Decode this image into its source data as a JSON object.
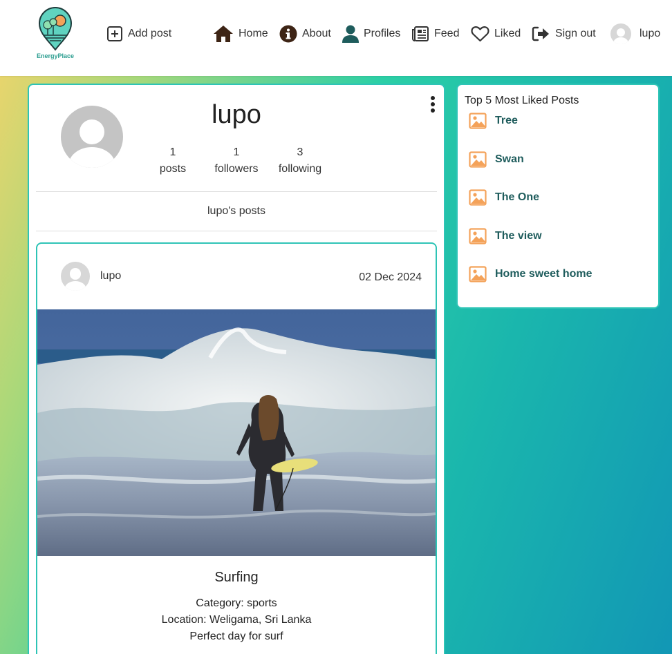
{
  "navbar": {
    "logo_text": "EnergyPlace",
    "items": [
      {
        "label": "Add post",
        "icon": "plus-square-icon"
      },
      {
        "label": "Home",
        "icon": "home-icon"
      },
      {
        "label": "About",
        "icon": "info-circle-icon"
      },
      {
        "label": "Profiles",
        "icon": "user-icon"
      },
      {
        "label": "Feed",
        "icon": "newspaper-icon"
      },
      {
        "label": "Liked",
        "icon": "heart-icon"
      },
      {
        "label": "Sign out",
        "icon": "sign-out-icon"
      }
    ],
    "user_label": "lupo"
  },
  "profile": {
    "name": "lupo",
    "stats": [
      {
        "value": "1",
        "label": "posts"
      },
      {
        "value": "1",
        "label": "followers"
      },
      {
        "value": "3",
        "label": "following"
      }
    ],
    "posts_heading": "lupo's posts"
  },
  "post": {
    "author": "lupo",
    "date": "02 Dec 2024",
    "title": "Surfing",
    "category": "Category: sports",
    "location": "Location: Weligama, Sri Lanka",
    "content": "Perfect day for surf"
  },
  "top_posts": {
    "title": "Top 5 Most Liked Posts",
    "items": [
      "Tree",
      "Swan",
      "The One",
      "The view",
      "Home sweet home"
    ]
  },
  "colors": {
    "accent": "#2ec4b6",
    "link": "#1e5c5c",
    "image_icon": "#f4a259"
  }
}
